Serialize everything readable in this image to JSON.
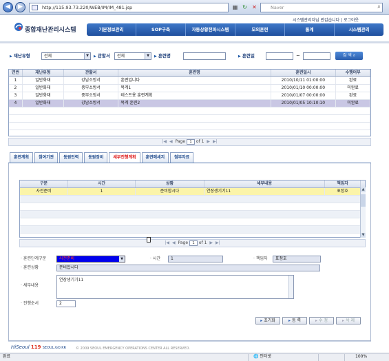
{
  "browser": {
    "back_glyph": "◀",
    "forward_glyph": "▶",
    "url": "http://115.93.73.220/WEB/IM/IM_481.jsp",
    "search_placeholder": "Naver"
  },
  "header": {
    "app_title": "종합재난관리시스템",
    "util_links": "시스템관리자님 반갑습니다 | 로그아웃",
    "brand_color": "#1f4f9e",
    "nav": [
      "기본정보관리",
      "SOP구축",
      "자동상황전파시스템",
      "모의훈련",
      "통계",
      "시스템관리"
    ]
  },
  "search": {
    "disaster_type_label": "재난유형",
    "disaster_type_value": "전체",
    "agency_label": "관할서",
    "agency_value": "전체",
    "drill_name_label": "훈련명",
    "drill_date_label": "훈련일",
    "date_separator": "~",
    "search_button": "검 색"
  },
  "drill_grid": {
    "columns": [
      "연번",
      "재난유형",
      "관할서",
      "훈련명",
      "훈련일시",
      "수행여부"
    ],
    "rows": [
      [
        "1",
        "일반화재",
        "강남소방서",
        "훈련입니다",
        "2010/10/11 01:00:00",
        "완료"
      ],
      [
        "2",
        "일반화재",
        "중부소방서",
        "목계1",
        "2010/01/10 00:00:00",
        "미완료"
      ],
      [
        "3",
        "일반화재",
        "중부소방서",
        "테스트용 훈련계획",
        "2010/01/07 00:00:00",
        "완료"
      ],
      [
        "4",
        "일반화재",
        "강남소방서",
        "목계 훈련2",
        "2010/01/05 10:10:10",
        "미완료"
      ]
    ],
    "selected_row_index": 3,
    "pager": {
      "page_label": "Page",
      "page": "1",
      "of_label": "of",
      "total": "1"
    }
  },
  "tabs": {
    "items": [
      "훈련계획",
      "참여기관",
      "동원인력",
      "동원장비",
      "세부진행계획",
      "훈련메세지",
      "첨부자료"
    ],
    "active_index": 4
  },
  "progress_grid": {
    "columns": [
      "구분",
      "시간",
      "상황",
      "세부내용",
      "책임자"
    ],
    "rows": [
      [
        "사전준비",
        "1",
        "준비합시다",
        "연장생기기11",
        "표정호"
      ]
    ],
    "pager": {
      "page_label": "Page",
      "page": "1",
      "of_label": "of",
      "total": "1"
    }
  },
  "form": {
    "stage_label": "훈련단계구분",
    "stage_value": "사전준비",
    "time_label": "시간",
    "time_value": "1",
    "person_label": "책임자",
    "person_value": "표정호",
    "situation_label": "훈련상황",
    "situation_value": "준비합시다",
    "detail_label": "세부내용",
    "detail_value": "연장생기기11",
    "order_label": "진행순서",
    "order_value": "2"
  },
  "actions": {
    "reset": "초기화",
    "register": "등 록",
    "edit": "수 정",
    "delete": "삭 제"
  },
  "footer": {
    "logo_prefix": "Hi",
    "logo_text": "Seoul",
    "logo_119": "119",
    "logo_domain": "SEOUL.GO.KR",
    "copyright": "© 2009 SEOUL EMERGENCY OPERATIONS CENTER ALL RESERVED."
  },
  "status_bar": {
    "done": "완료",
    "zone": "인터넷",
    "zoom": "100%"
  }
}
